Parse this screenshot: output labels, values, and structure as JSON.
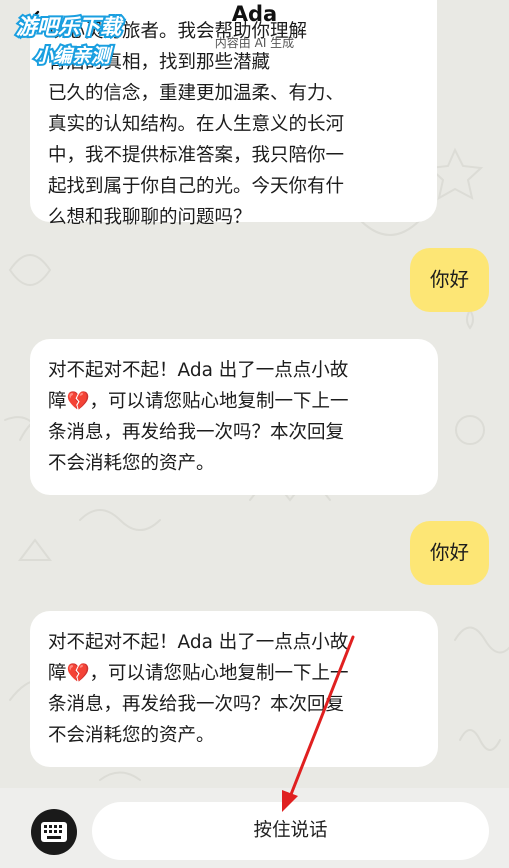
{
  "header": {
    "title": "Ada",
    "subtitle": "内容由 AI 生成",
    "back_icon": "chevron-left-icon"
  },
  "watermark": {
    "line1": "游吧乐下载",
    "line2": "小编亲测"
  },
  "messages": [
    {
      "role": "assistant",
      "text": "以心灵为旅者。我会帮助你理解\n背后的真相，找到那些潜藏\n已久的信念，重建更加温柔、有力、\n真实的认知结构。在人生意义的长河\n中，我不提供标准答案，我只陪你一\n起找到属于你自己的光。今天你有什\n么想和我聊聊的问题吗？"
    },
    {
      "role": "user",
      "text": "你好"
    },
    {
      "role": "assistant",
      "text": "对不起对不起！Ada 出了一点点小故\n障💔，可以请您贴心地复制一下上一\n条消息，再发给我一次吗？本次回复\n不会消耗您的资产。"
    },
    {
      "role": "user",
      "text": "你好"
    },
    {
      "role": "assistant",
      "text": "对不起对不起！Ada 出了一点点小故\n障💔，可以请您贴心地复制一下上一\n条消息，再发给我一次吗？本次回复\n不会消耗您的资产。"
    }
  ],
  "input_bar": {
    "keyboard_icon": "keyboard-icon",
    "voice_label": "按住说话"
  },
  "colors": {
    "background": "#e9e9e4",
    "user_bubble": "#fde675",
    "assistant_bubble": "#ffffff",
    "annotation_arrow": "#e02020"
  }
}
